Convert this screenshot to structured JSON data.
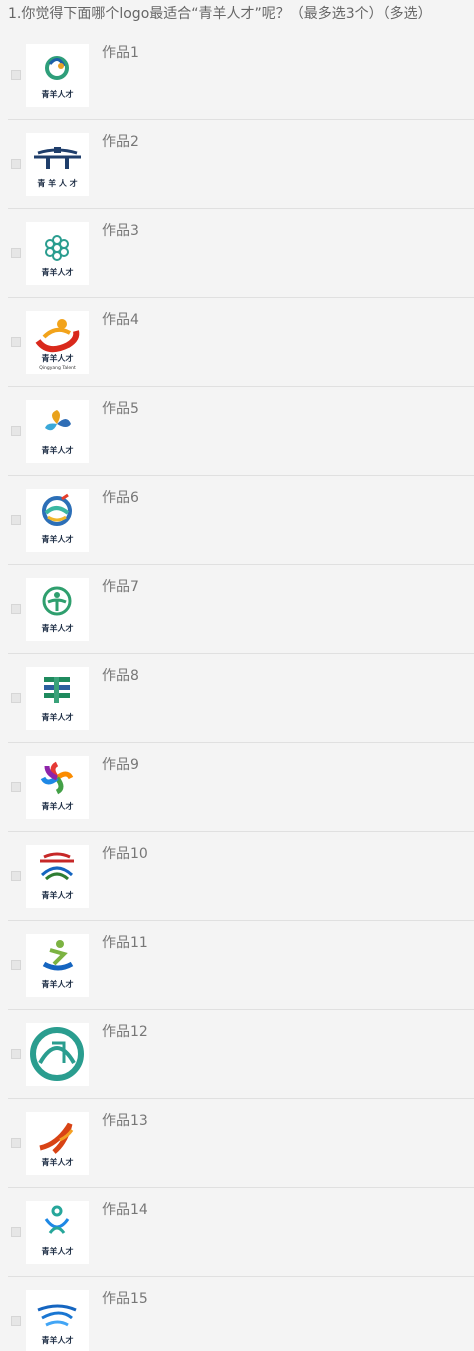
{
  "question": {
    "title": "1.你觉得下面哪个logo最适合“青羊人才”呢？（最多选3个）（多选）",
    "options": [
      {
        "label": "作品1",
        "logo_text": "青羊人才",
        "icon": "spiral-emblem-logo"
      },
      {
        "label": "作品2",
        "logo_text": "青 羊 人 才",
        "icon": "gate-archway-logo"
      },
      {
        "label": "作品3",
        "logo_text": "青羊人才",
        "icon": "snowflake-flower-logo"
      },
      {
        "label": "作品4",
        "logo_text": "青羊人才",
        "icon": "red-swirl-logo",
        "sub": "Qingyang Talent"
      },
      {
        "label": "作品5",
        "logo_text": "青羊人才",
        "icon": "pinwheel-logo"
      },
      {
        "label": "作品6",
        "logo_text": "青羊人才",
        "icon": "wave-circle-logo"
      },
      {
        "label": "作品7",
        "logo_text": "青羊人才",
        "icon": "green-figure-circle-logo"
      },
      {
        "label": "作品8",
        "logo_text": "青羊人才",
        "icon": "green-character-logo"
      },
      {
        "label": "作品9",
        "logo_text": "青羊人才",
        "icon": "rainbow-flower-logo"
      },
      {
        "label": "作品10",
        "logo_text": "青羊人才",
        "icon": "layered-arch-logo"
      },
      {
        "label": "作品11",
        "logo_text": "青羊人才",
        "icon": "leaping-figure-logo"
      },
      {
        "label": "作品12",
        "logo_text": "",
        "icon": "teal-dome-logo"
      },
      {
        "label": "作品13",
        "logo_text": "青羊人才",
        "icon": "red-phoenix-logo"
      },
      {
        "label": "作品14",
        "logo_text": "青羊人才",
        "icon": "interlocked-figures-logo"
      },
      {
        "label": "作品15",
        "logo_text": "青羊人才",
        "icon": "blue-wave-logo"
      }
    ]
  },
  "colors": {
    "background": "#f4f4f4",
    "title_text": "#666666",
    "label_text": "#777777"
  }
}
